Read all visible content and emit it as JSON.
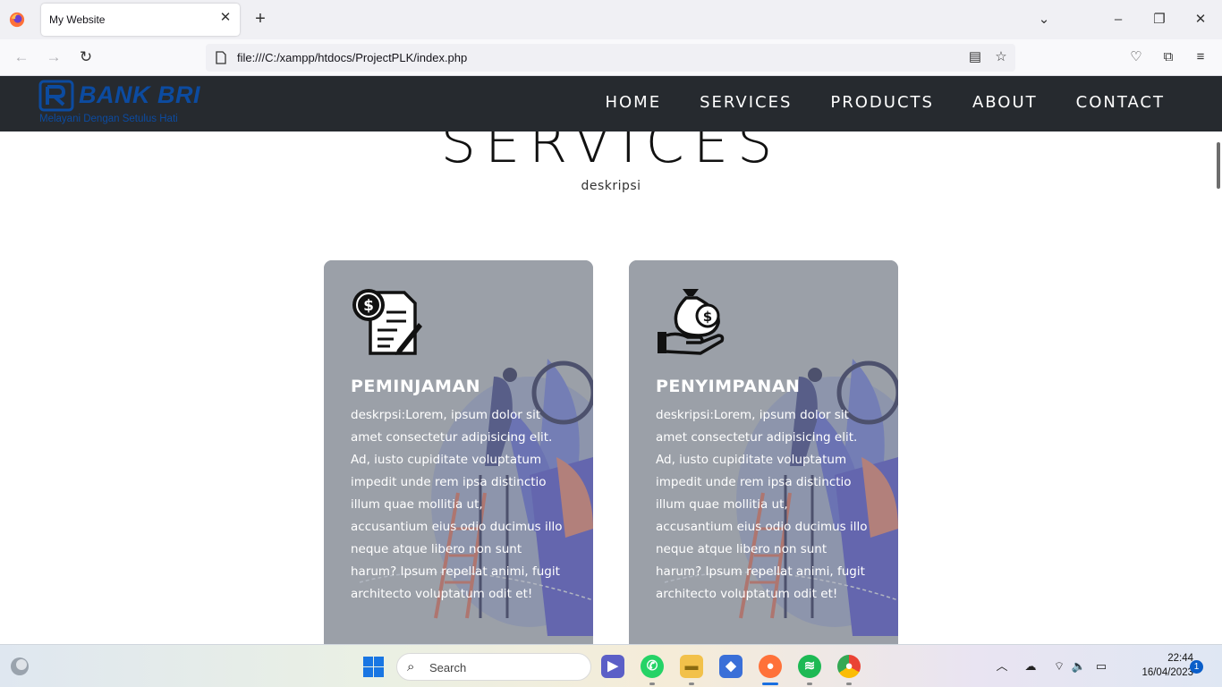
{
  "browser": {
    "tab_title": "My Website",
    "url": "file:///C:/xampp/htdocs/ProjectPLK/index.php"
  },
  "site": {
    "logo_text": "BANK BRI",
    "tagline": "Melayani Dengan Setulus Hati",
    "nav": [
      "HOME",
      "SERVICES",
      "PRODUCTS",
      "ABOUT",
      "CONTACT"
    ],
    "section_title": "SERVICES",
    "section_desc": "deskripsi",
    "cards": [
      {
        "title": "PEMINJAMAN",
        "icon": "loan-document-icon",
        "text": "deskrpsi:Lorem, ipsum dolor sit amet consectetur adipisicing elit. Ad, iusto cupiditate voluptatum impedit unde rem ipsa distinctio illum quae mollitia ut, accusantium eius odio ducimus illo neque atque libero non sunt harum? Ipsum repellat animi, fugit architecto voluptatum odit et!"
      },
      {
        "title": "PENYIMPANAN",
        "icon": "money-bag-hand-icon",
        "text": "deskripsi:Lorem, ipsum dolor sit amet consectetur adipisicing elit. Ad, iusto cupiditate voluptatum impedit unde rem ipsa distinctio illum quae mollitia ut, accusantium eius odio ducimus illo neque atque libero non sunt harum? Ipsum repellat animi, fugit architecto voluptatum odit et!"
      }
    ]
  },
  "taskbar": {
    "search_label": "Search",
    "time": "22:44",
    "date": "16/04/2023",
    "notifications": "1"
  },
  "colors": {
    "header_bg": "#262a2f",
    "brand_blue": "#0c4ba0",
    "card_bg": "#9da3ab"
  }
}
